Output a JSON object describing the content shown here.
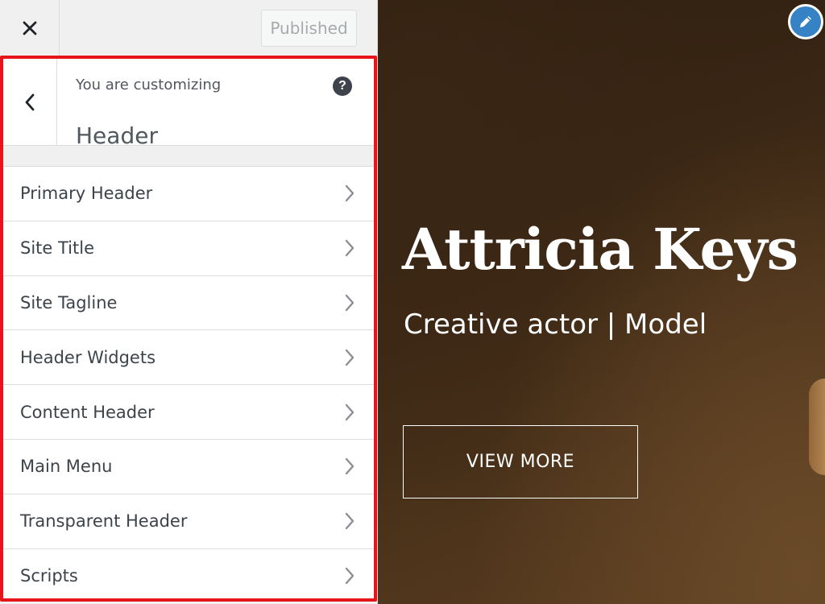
{
  "topbar": {
    "close_icon": "close-icon",
    "publish_label": "Published"
  },
  "panel": {
    "subtitle": "You are customizing",
    "title": "Header",
    "back_icon": "chevron-left-icon",
    "help_label": "?"
  },
  "menu": {
    "items": [
      {
        "label": "Primary Header"
      },
      {
        "label": "Site Title"
      },
      {
        "label": "Site Tagline"
      },
      {
        "label": "Header Widgets"
      },
      {
        "label": "Content Header"
      },
      {
        "label": "Main Menu"
      },
      {
        "label": "Transparent Header"
      },
      {
        "label": "Scripts"
      }
    ]
  },
  "preview": {
    "title": "Attricia Keys",
    "subtitle": "Creative actor | Model",
    "button_label": "VIEW MORE",
    "edit_icon": "pencil-icon"
  },
  "colors": {
    "highlight_border": "#e8141c",
    "edit_button": "#3582c4",
    "sidebar_bg": "#f0f0f1"
  }
}
